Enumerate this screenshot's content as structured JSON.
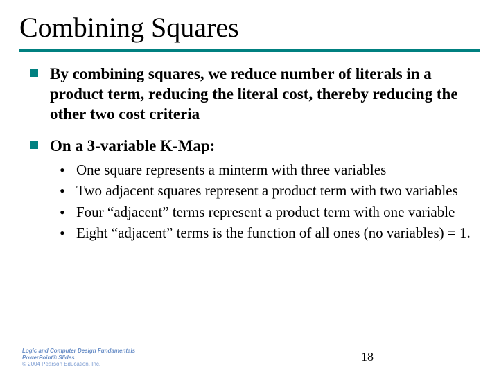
{
  "title": "Combining Squares",
  "bullets": [
    {
      "text": "By combining squares, we reduce number of literals in a product term, reducing the literal cost, thereby reducing the other two cost criteria"
    },
    {
      "text": "On a 3-variable K-Map:",
      "sub": [
        "One square represents a minterm with three variables",
        "Two adjacent squares represent a product term with two variables",
        "Four “adjacent” terms represent a product term with one variable",
        "Eight “adjacent” terms is the function of all ones (no variables) = 1."
      ]
    }
  ],
  "footer": {
    "line1": "Logic and Computer Design Fundamentals",
    "line2": "PowerPoint® Slides",
    "line3": "© 2004 Pearson Education, Inc."
  },
  "page_number": "18",
  "accent_color": "#008080"
}
